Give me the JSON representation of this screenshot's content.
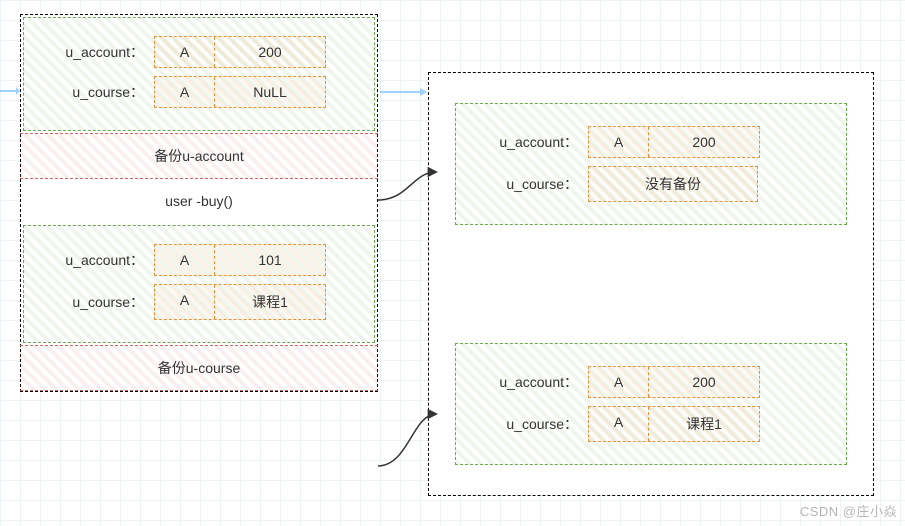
{
  "left": {
    "before": {
      "u_account": {
        "label": "u_account：",
        "key": "A",
        "value": "200"
      },
      "u_course": {
        "label": "u_course：",
        "key": "A",
        "value": "NuLL"
      }
    },
    "backup_account": "备份u-account",
    "action": "user -buy()",
    "after": {
      "u_account": {
        "label": "u_account：",
        "key": "A",
        "value": "101"
      },
      "u_course": {
        "label": "u_course：",
        "key": "A",
        "value": "课程1"
      }
    },
    "backup_course": "备份u-course"
  },
  "right": {
    "snap1": {
      "u_account": {
        "label": "u_account：",
        "key": "A",
        "value": "200"
      },
      "u_course": {
        "label": "u_course：",
        "no_backup": "没有备份"
      }
    },
    "snap2": {
      "u_account": {
        "label": "u_account：",
        "key": "A",
        "value": "200"
      },
      "u_course": {
        "label": "u_course：",
        "key": "A",
        "value": "课程1"
      }
    }
  },
  "watermark": "CSDN @庄小焱"
}
